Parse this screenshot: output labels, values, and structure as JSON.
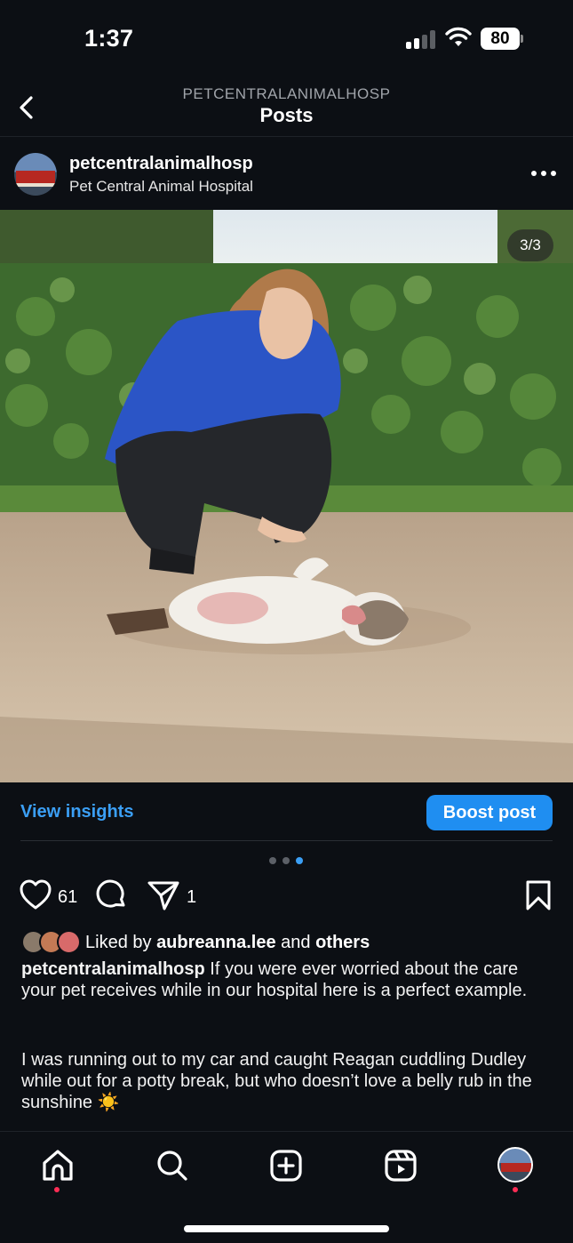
{
  "status_bar": {
    "time": "1:37",
    "battery": "80"
  },
  "header": {
    "account": "PETCENTRALANIMALHOSP",
    "title": "Posts"
  },
  "post": {
    "username": "petcentralanimalhosp",
    "full_name": "Pet Central Animal Hospital",
    "image_counter": "3/3",
    "carousel": {
      "total": 3,
      "active": 3
    },
    "view_insights_label": "View insights",
    "boost_label": "Boost post",
    "likes_count": "61",
    "shares_count": "1",
    "liked_by_prefix": "Liked by",
    "liked_by_user": "aubreanna.lee",
    "liked_by_and": "and",
    "liked_by_others": "others",
    "caption_username": "petcentralanimalhosp",
    "caption_text": " If you were ever worried about the care your pet receives while in our hospital here is a perfect example.",
    "caption_text_2": "I was running out to my car and caught Reagan cuddling Dudley while out for a potty break, but who doesn’t love a belly rub in the sunshine ☀️"
  },
  "colors": {
    "accent": "#3b9ff5",
    "boost": "#1f8ef1",
    "background": "#0c0f14",
    "notification": "#ff2d55"
  },
  "tabs": [
    {
      "icon": "home-icon",
      "active": true
    },
    {
      "icon": "search-icon"
    },
    {
      "icon": "create-icon"
    },
    {
      "icon": "reels-icon"
    },
    {
      "icon": "profile-avatar"
    }
  ]
}
